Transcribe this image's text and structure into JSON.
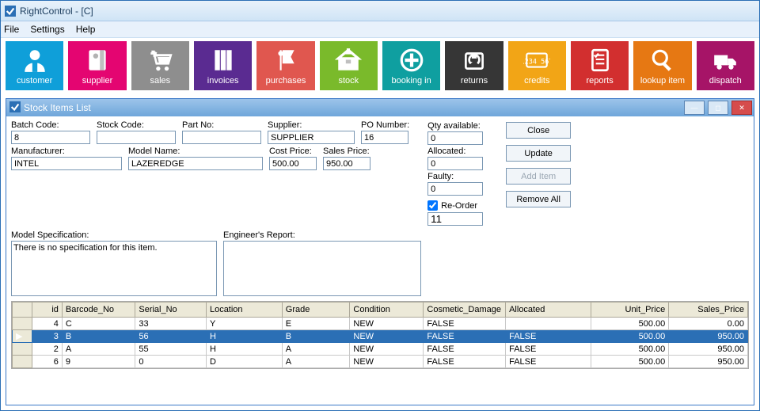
{
  "window": {
    "title": "RightControl - [C]"
  },
  "menu": {
    "file": "File",
    "settings": "Settings",
    "help": "Help"
  },
  "toolbar": [
    {
      "name": "customer-button",
      "label": "customer",
      "color": "#0f9fd9",
      "icon": "customer"
    },
    {
      "name": "supplier-button",
      "label": "supplier",
      "color": "#e40571",
      "icon": "supplier"
    },
    {
      "name": "sales-button",
      "label": "sales",
      "color": "#8e8e8e",
      "icon": "sales"
    },
    {
      "name": "invoices-button",
      "label": "invoices",
      "color": "#5a2b91",
      "icon": "invoices"
    },
    {
      "name": "purchases-button",
      "label": "purchases",
      "color": "#e0574f",
      "icon": "purchases"
    },
    {
      "name": "stock-button",
      "label": "stock",
      "color": "#7aba2b",
      "icon": "stock"
    },
    {
      "name": "bookingin-button",
      "label": "booking in",
      "color": "#0f9fa0",
      "icon": "booking"
    },
    {
      "name": "returns-button",
      "label": "returns",
      "color": "#363636",
      "icon": "returns"
    },
    {
      "name": "credits-button",
      "label": "credits",
      "color": "#f2a516",
      "icon": "credits"
    },
    {
      "name": "reports-button",
      "label": "reports",
      "color": "#d22f2f",
      "icon": "reports"
    },
    {
      "name": "lookup-button",
      "label": "lookup item",
      "color": "#e67813",
      "icon": "lookup"
    },
    {
      "name": "dispatch-button",
      "label": "dispatch",
      "color": "#a61467",
      "icon": "dispatch"
    }
  ],
  "inner": {
    "title": "Stock Items List",
    "buttons": {
      "close": "Close",
      "update": "Update",
      "add": "Add Item",
      "remove": "Remove All"
    },
    "labels": {
      "batch": "Batch Code:",
      "stock": "Stock Code:",
      "partno": "Part No:",
      "supplier": "Supplier:",
      "ponum": "PO Number:",
      "manufacturer": "Manufacturer:",
      "model": "Model Name:",
      "cost": "Cost Price:",
      "sales": "Sales Price:",
      "modelspec": "Model Specification:",
      "engreport": "Engineer's Report:",
      "qty": "Qty available:",
      "allocated": "Allocated:",
      "faulty": "Faulty:",
      "reorder": "Re-Order"
    },
    "values": {
      "batch": "8",
      "stock": "",
      "partno": "",
      "supplier": "SUPPLIER",
      "ponum": "16",
      "manufacturer": "INTEL",
      "model": "LAZEREDGE",
      "cost": "500.00",
      "sales": "950.00",
      "modelspec": "There is no specification for this item.",
      "engreport": "",
      "qty": "0",
      "allocated": "0",
      "faulty": "0",
      "reorder_checked": true,
      "reorder": "11"
    },
    "table": {
      "cols": [
        "id",
        "Barcode_No",
        "Serial_No",
        "Location",
        "Grade",
        "Condition",
        "Cosmetic_Damage",
        "Allocated",
        "Unit_Price",
        "Sales_Price"
      ],
      "rows": [
        {
          "id": "4",
          "Barcode_No": "C",
          "Serial_No": "33",
          "Location": "Y",
          "Grade": "E",
          "Condition": "NEW",
          "Cosmetic_Damage": "FALSE",
          "Allocated": "",
          "Unit_Price": "500.00",
          "Sales_Price": "0.00"
        },
        {
          "id": "3",
          "Barcode_No": "B",
          "Serial_No": "56",
          "Location": "H",
          "Grade": "B",
          "Condition": "NEW",
          "Cosmetic_Damage": "FALSE",
          "Allocated": "FALSE",
          "Unit_Price": "500.00",
          "Sales_Price": "950.00",
          "selected": true
        },
        {
          "id": "2",
          "Barcode_No": "A",
          "Serial_No": "55",
          "Location": "H",
          "Grade": "A",
          "Condition": "NEW",
          "Cosmetic_Damage": "FALSE",
          "Allocated": "FALSE",
          "Unit_Price": "500.00",
          "Sales_Price": "950.00"
        },
        {
          "id": "6",
          "Barcode_No": "9",
          "Serial_No": "0",
          "Location": "D",
          "Grade": "A",
          "Condition": "NEW",
          "Cosmetic_Damage": "FALSE",
          "Allocated": "FALSE",
          "Unit_Price": "500.00",
          "Sales_Price": "950.00"
        }
      ]
    }
  }
}
